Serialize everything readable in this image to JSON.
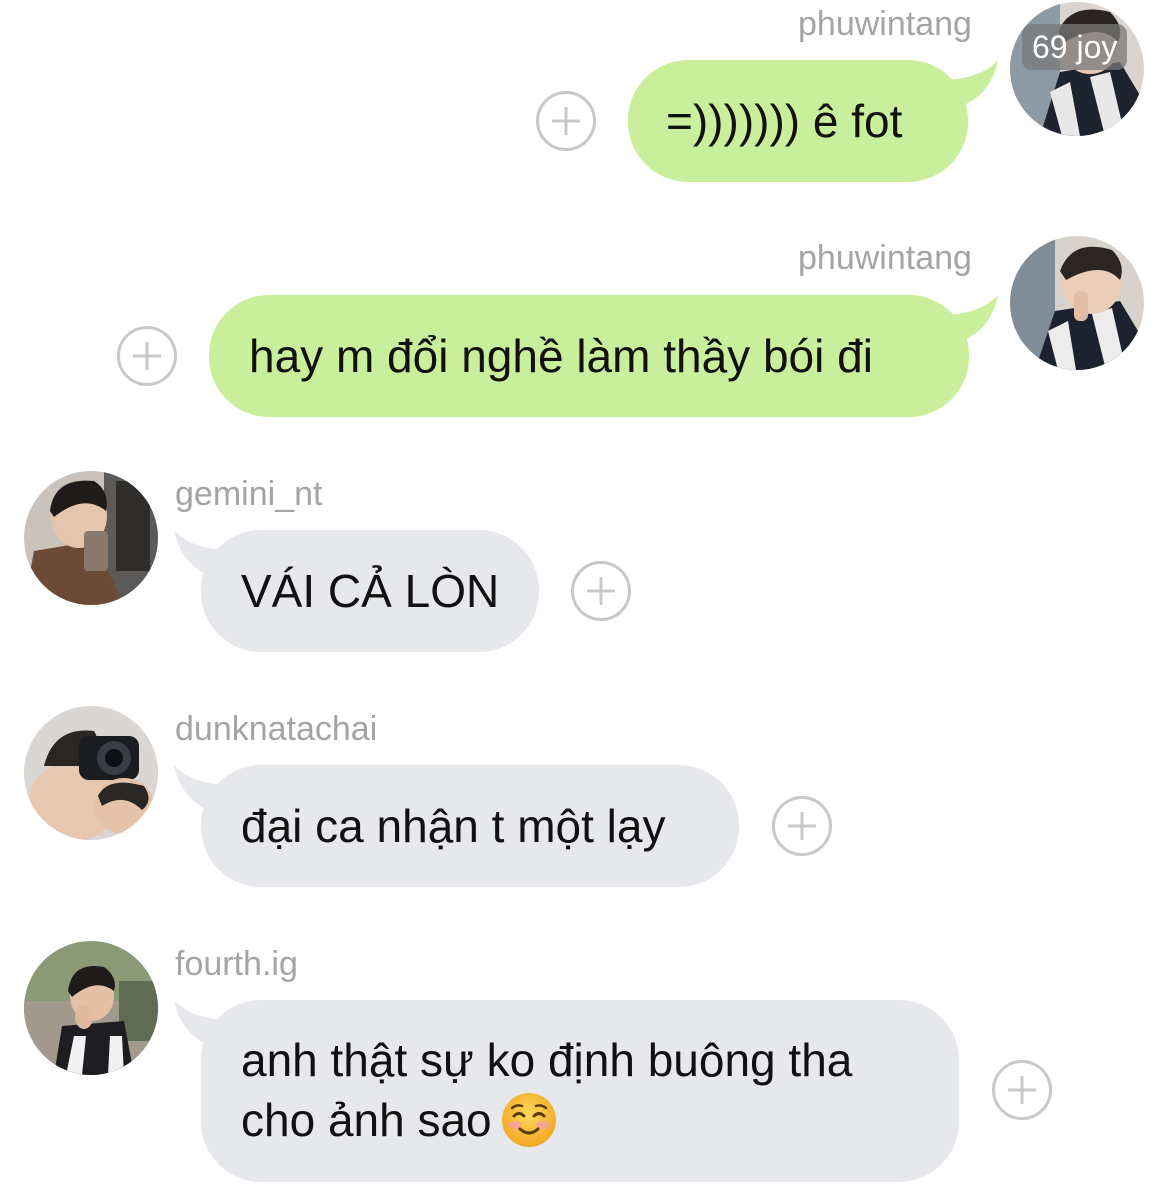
{
  "messages": [
    {
      "id": "m1",
      "username": "phuwintang",
      "text": "=))))))) ê fot",
      "direction": "sent",
      "reaction_badge": "69 joy"
    },
    {
      "id": "m2",
      "username": "phuwintang",
      "text": "hay m đổi nghề làm thầy bói đi",
      "direction": "sent"
    },
    {
      "id": "m3",
      "username": "gemini_nt",
      "text": "VÁI CẢ LÒN",
      "direction": "received"
    },
    {
      "id": "m4",
      "username": "dunknatachai",
      "text": "đại ca nhận t một lạy",
      "direction": "received"
    },
    {
      "id": "m5",
      "username": "fourth.ig",
      "text_line1": "anh thật sự ko định buông tha",
      "text_line2": "cho ảnh sao",
      "emoji": "smiling-face-emoji",
      "direction": "received"
    }
  ],
  "colors": {
    "sent_bubble": "#caef9c",
    "received_bubble": "#e6e8ec",
    "username_text": "#a4a4a4",
    "add_button_stroke": "#c8c8c8"
  },
  "icons": {
    "add_reaction": "plus-circle-icon"
  }
}
